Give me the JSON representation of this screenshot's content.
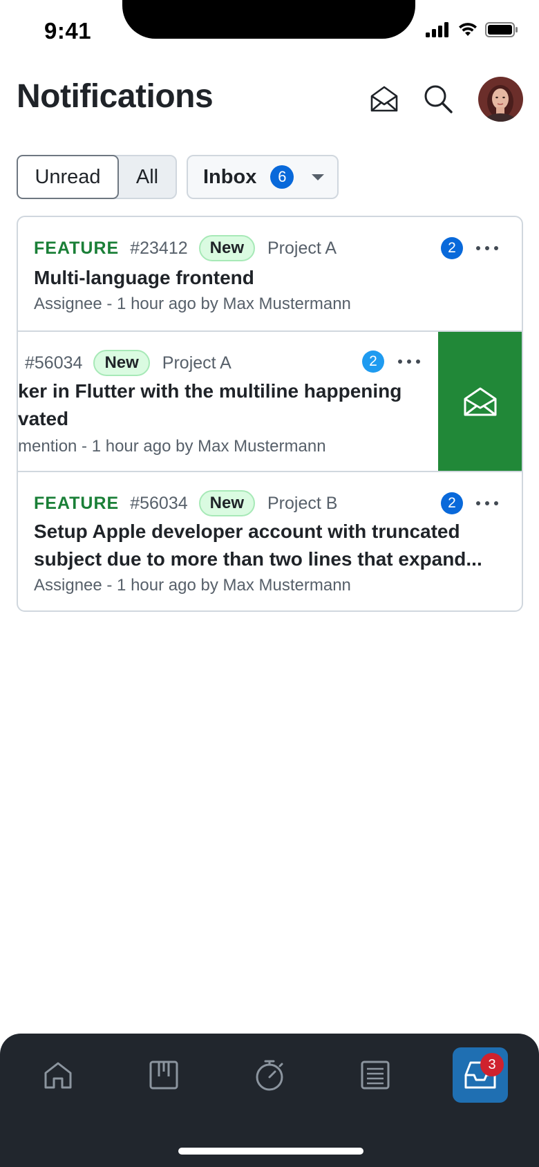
{
  "status_bar": {
    "time": "9:41"
  },
  "header": {
    "title": "Notifications",
    "icons": [
      "mail-open-icon",
      "search-icon",
      "avatar"
    ]
  },
  "filters": {
    "unread_label": "Unread",
    "all_label": "All",
    "selected": "Unread",
    "inbox_label": "Inbox",
    "inbox_count": "6"
  },
  "notifications": [
    {
      "type": "FEATURE",
      "number": "#23412",
      "status": "New",
      "project": "Project A",
      "unread_count": "2",
      "subject_line1": "Multi-language frontend",
      "subject_line2": "",
      "subtitle": "Assignee - 1 hour ago by Max Mustermann"
    },
    {
      "number": "#56034",
      "status": "New",
      "project": "Project A",
      "unread_count": "2",
      "subject_line1": "ker in Flutter with the multiline happening",
      "subject_line2": "vated",
      "subtitle": "mention - 1 hour ago by Max Mustermann",
      "swipe_action_icon": "mail-open-icon"
    },
    {
      "type": "FEATURE",
      "number": "#56034",
      "status": "New",
      "project": "Project B",
      "unread_count": "2",
      "subject_line1": "Setup Apple developer account with truncated",
      "subject_line2": "subject due to more than two lines that expand...",
      "subtitle": "Assignee - 1 hour ago by Max Mustermann"
    }
  ],
  "tabbar": {
    "tabs": [
      "home-icon",
      "board-icon",
      "timer-icon",
      "list-icon",
      "inbox-icon"
    ],
    "active_tab": "inbox-icon",
    "inbox_badge": "3"
  },
  "colors": {
    "accent": "#0969da",
    "feature_green": "#1a7f37",
    "swipe_green": "#218838",
    "tabbar_bg": "#21262d",
    "active_tab_bg": "#1f6fb2",
    "badge_red": "#cf222e"
  }
}
